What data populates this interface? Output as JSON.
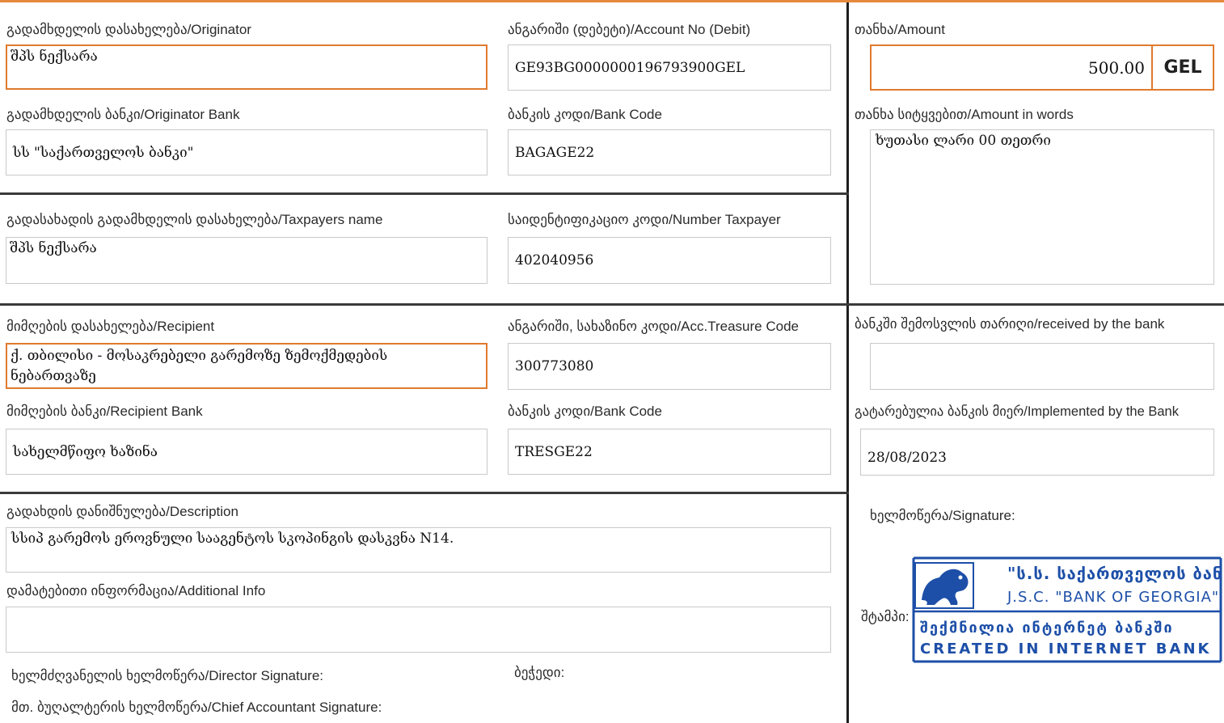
{
  "originator": {
    "label": "გადამხდელის დასახელება/Originator",
    "value": "შპს ნექსარა"
  },
  "account_debit": {
    "label": "ანგარიში (დებეტი)/Account No (Debit)",
    "value": "GE93BG0000000196793900GEL"
  },
  "amount": {
    "label": "თანხა/Amount",
    "value": "500.00",
    "currency": "GEL"
  },
  "originator_bank": {
    "label": "გადამხდელის ბანკი/Originator Bank",
    "value": "სს \"საქართველოს ბანკი\""
  },
  "bank_code_1": {
    "label": "ბანკის კოდი/Bank Code",
    "value": "BAGAGE22"
  },
  "amount_words": {
    "label": "თანხა სიტყვებით/Amount in words",
    "value": "ხუთასი ლარი 00 თეთრი"
  },
  "taxpayer_name": {
    "label": "გადასახადის გადამხდელის დასახელება/Taxpayers name",
    "value": "შპს ნექსარა"
  },
  "taxpayer_number": {
    "label": "საიდენტიფიკაციო კოდი/Number Taxpayer",
    "value": "402040956"
  },
  "recipient": {
    "label": "მიმღების დასახელება/Recipient",
    "value_line1": "ქ. თბილისი - მოსაკრებელი გარემოზე ზემოქმედების",
    "value_line2": "ნებართვაზე"
  },
  "treasury_code": {
    "label": "ანგარიში, სახაზინო კოდი/Acc.Treasure Code",
    "value": "300773080"
  },
  "received_date": {
    "label": "ბანკში შემოსვლის თარიღი/received by the bank",
    "value": ""
  },
  "recipient_bank": {
    "label": "მიმღების ბანკი/Recipient Bank",
    "value": "სახელმწიფო ხაზინა"
  },
  "bank_code_2": {
    "label": "ბანკის კოდი/Bank Code",
    "value": "TRESGE22"
  },
  "implemented": {
    "label": "გატარებულია ბანკის მიერ/Implemented by the Bank",
    "value": "28/08/2023"
  },
  "description": {
    "label": "გადახდის დანიშნულება/Description",
    "value": "სსიპ გარემოს ეროვნული სააგენტოს სკოპინგის დასკვნა N14."
  },
  "signature": {
    "label": "ხელმოწერა/Signature:"
  },
  "additional": {
    "label": "დამატებითი ინფორმაცია/Additional Info",
    "value": ""
  },
  "stamp": {
    "label": "შტამპი:",
    "line_ge_top": "\"ს.ს. საქართველოს ბანკი\"",
    "line_en_top": "J.S.C. \"BANK OF GEORGIA\"",
    "line_ge_bottom": "შექმნილია ინტერნეტ ბანკში",
    "line_en_bottom": "CREATED IN INTERNET BANK"
  },
  "director_signature": {
    "label": "ხელმძღვანელის ხელმოწერა/Director Signature:"
  },
  "seal": {
    "label": "ბეჭედი:"
  },
  "accountant_signature": {
    "label": "მთ. ბუღალტერის ხელმოწერა/Chief Accountant Signature:"
  },
  "colors": {
    "accent": "#e07a2e",
    "stamp_blue": "#1d4fa8"
  }
}
